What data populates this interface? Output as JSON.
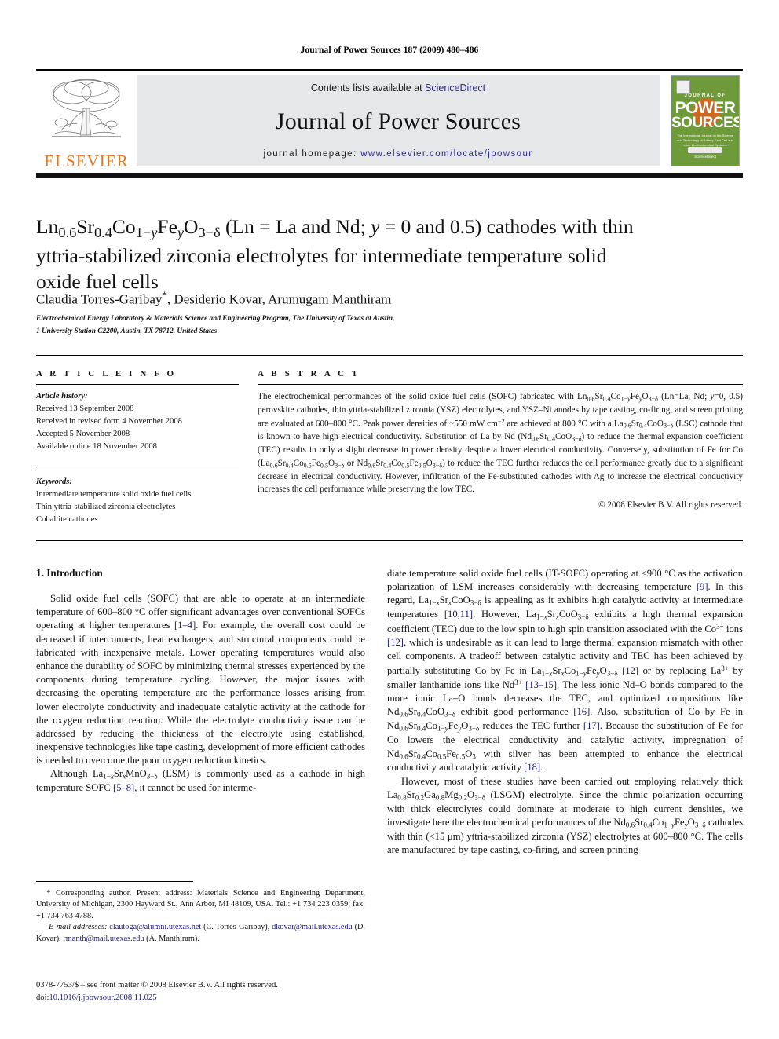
{
  "running_head": "Journal of Power Sources 187 (2009) 480–486",
  "masthead": {
    "publisher_name": "ELSEVIER",
    "contents_prefix": "Contents lists available at ",
    "contents_link": "ScienceDirect",
    "journal_name": "Journal of Power Sources",
    "homepage_prefix": "journal homepage: ",
    "homepage_url": "www.elsevier.com/locate/jpowsour",
    "cover": {
      "top_label": "JOURNAL OF",
      "word1": "POWER",
      "word2": "SOURCES",
      "subtitle": "The International Journal on the Science and Technology of Battery, Fuel Cell and other Electrochemical Systems",
      "footer": "ScienceDirect"
    },
    "accent_orange": "#E87722",
    "link_blue": "#2a2a8c",
    "cover_green": "#6f9a3a"
  },
  "article": {
    "title_html": "Ln<sub>0.6</sub>Sr<sub>0.4</sub>Co<sub>1−<i>y</i></sub>Fe<sub><i>y</i></sub>O<sub>3−δ</sub> (Ln = La and Nd; <i>y</i> = 0 and 0.5) cathodes with thin yttria-stabilized zirconia electrolytes for intermediate temperature solid oxide fuel cells",
    "authors_html": "Claudia Torres-Garibay<span class=\"star\">*</span>, Desiderio Kovar, Arumugam Manthiram",
    "affiliation_line1": "Electrochemical Energy Laboratory & Materials Science and Engineering Program, The University of Texas at Austin,",
    "affiliation_line2": "1 University Station C2200, Austin, TX 78712, United States"
  },
  "article_info": {
    "heading": "A R T I C L E   I N F O",
    "history_label": "Article history:",
    "history": [
      "Received 13 September 2008",
      "Received in revised form 4 November 2008",
      "Accepted 5 November 2008",
      "Available online 18 November 2008"
    ],
    "keywords_label": "Keywords:",
    "keywords": [
      "Intermediate temperature solid oxide fuel cells",
      "Thin yttria-stabilized zirconia electrolytes",
      "Cobaltite cathodes"
    ]
  },
  "abstract": {
    "heading": "A B S T R A C T",
    "body_html": "The electrochemical performances of the solid oxide fuel cells (SOFC) fabricated with Ln<sub>0.6</sub>Sr<sub>0.4</sub>Co<sub>1−<i>y</i></sub>Fe<sub><i>y</i></sub>O<sub>3−δ</sub> (Ln=La, Nd; <i>y</i>=0, 0.5) perovskite cathodes, thin yttria-stabilized zirconia (YSZ) electrolytes, and YSZ–Ni anodes by tape casting, co-firing, and screen printing are evaluated at 600–800 °C. Peak power densities of ~550 mW cm<sup>−2</sup> are achieved at 800 °C with a La<sub>0.6</sub>Sr<sub>0.4</sub>CoO<sub>3−δ</sub> (LSC) cathode that is known to have high electrical conductivity. Substitution of La by Nd (Nd<sub>0.6</sub>Sr<sub>0.4</sub>CoO<sub>3−δ</sub>) to reduce the thermal expansion coefficient (TEC) results in only a slight decrease in power density despite a lower electrical conductivity. Conversely, substitution of Fe for Co (La<sub>0.6</sub>Sr<sub>0.4</sub>Co<sub>0.5</sub>Fe<sub>0.5</sub>O<sub>3−δ</sub> or Nd<sub>0.6</sub>Sr<sub>0.4</sub>Co<sub>0.5</sub>Fe<sub>0.5</sub>O<sub>3−δ</sub>) to reduce the TEC further reduces the cell performance greatly due to a significant decrease in electrical conductivity. However, infiltration of the Fe-substituted cathodes with Ag to increase the electrical conductivity increases the cell performance while preserving the low TEC.",
    "copyright": "© 2008 Elsevier B.V. All rights reserved."
  },
  "introduction": {
    "heading": "1.  Introduction",
    "left_paragraphs_html": [
      "Solid oxide fuel cells (SOFC) that are able to operate at an intermediate temperature of 600–800 °C offer significant advantages over conventional SOFCs operating at higher temperatures <span class=\"ref\">[1–4]</span>. For example, the overall cost could be decreased if interconnects, heat exchangers, and structural components could be fabricated with inexpensive metals. Lower operating temperatures would also enhance the durability of SOFC by minimizing thermal stresses experienced by the components during temperature cycling. However, the major issues with decreasing the operating temperature are the performance losses arising from lower electrolyte conductivity and inadequate catalytic activity at the cathode for the oxygen reduction reaction. While the electrolyte conductivity issue can be addressed by reducing the thickness of the electrolyte using established, inexpensive technologies like tape casting, development of more efficient cathodes is needed to overcome the poor oxygen reduction kinetics.",
      "Although La<sub>1−<i>x</i></sub>Sr<sub><i>x</i></sub>MnO<sub>3−δ</sub> (LSM) is commonly used as a cathode in high temperature SOFC <span class=\"ref\">[5–8]</span>, it cannot be used for interme-"
    ],
    "right_paragraphs_html": [
      "diate temperature solid oxide fuel cells (IT-SOFC) operating at &lt;900 °C as the activation polarization of LSM increases considerably with decreasing temperature <span class=\"ref\">[9]</span>. In this regard, La<sub>1−<i>x</i></sub>Sr<sub><i>x</i></sub>CoO<sub>3−δ</sub> is appealing as it exhibits high catalytic activity at intermediate temperatures <span class=\"ref\">[10,11]</span>. However, La<sub>1−<i>x</i></sub>Sr<sub><i>x</i></sub>CoO<sub>3−δ</sub> exhibits a high thermal expansion coefficient (TEC) due to the low spin to high spin transition associated with the Co<sup>3+</sup> ions <span class=\"ref\">[12]</span>, which is undesirable as it can lead to large thermal expansion mismatch with other cell components. A tradeoff between catalytic activity and TEC has been achieved by partially substituting Co by Fe in La<sub>1−<i>x</i></sub>Sr<sub><i>x</i></sub>Co<sub>1−<i>y</i></sub>Fe<sub><i>y</i></sub>O<sub>3−δ</sub> <span class=\"ref\">[12]</span> or by replacing La<sup>3+</sup> by smaller lanthanide ions like Nd<sup>3+</sup> <span class=\"ref\">[13–15]</span>. The less ionic Nd–O bonds compared to the more ionic La–O bonds decreases the TEC, and optimized compositions like Nd<sub>0.6</sub>Sr<sub>0.4</sub>CoO<sub>3−δ</sub> exhibit good performance <span class=\"ref\">[16]</span>. Also, substitution of Co by Fe in Nd<sub>0.6</sub>Sr<sub>0.4</sub>Co<sub>1−<i>y</i></sub>Fe<sub><i>y</i></sub>O<sub>3−δ</sub> reduces the TEC further <span class=\"ref\">[17]</span>. Because the substitution of Fe for Co lowers the electrical conductivity and catalytic activity, impregnation of Nd<sub>0.6</sub>Sr<sub>0.4</sub>Co<sub>0.5</sub>Fe<sub>0.5</sub>O<sub>3</sub> with silver has been attempted to enhance the electrical conductivity and catalytic activity <span class=\"ref\">[18]</span>.",
      "However, most of these studies have been carried out employing relatively thick La<sub>0.8</sub>Sr<sub>0.2</sub>Ga<sub>0.8</sub>Mg<sub>0.2</sub>O<sub>3−δ</sub> (LSGM) electrolyte. Since the ohmic polarization occurring with thick electrolytes could dominate at moderate to high current densities, we investigate here the electrochemical performances of the Nd<sub>0.6</sub>Sr<sub>0.4</sub>Co<sub>1−<i>y</i></sub>Fe<sub><i>y</i></sub>O<sub>3−δ</sub> cathodes with thin (&lt;15 μm) yttria-stabilized zirconia (YSZ) electrolytes at 600–800 °C. The cells are manufactured by tape casting, co-firing, and screen printing"
    ]
  },
  "footnotes": {
    "corresponding_html": "&nbsp;&nbsp;* Corresponding author. Present address: Materials Science and Engineering Department, University of Michigan, 2300 Hayward St., Ann Arbor, MI 48109, USA. Tel.: +1 734 223 0359; fax: +1 734 763 4788.",
    "emails_html": "<span class=\"em\">E-mail addresses:</span> <span class=\"mailto\">clautoga@alumni.utexas.net</span> (C. Torres-Garibay), <span class=\"mailto\">dkovar@mail.utexas.edu</span> (D. Kovar), <span class=\"mailto\">rmanth@mail.utexas.edu</span> (A. Manthiram).",
    "issn_line": "0378-7753/$ – see front matter © 2008 Elsevier B.V. All rights reserved.",
    "doi_prefix": "doi:",
    "doi_value": "10.1016/j.jpowsour.2008.11.025"
  }
}
